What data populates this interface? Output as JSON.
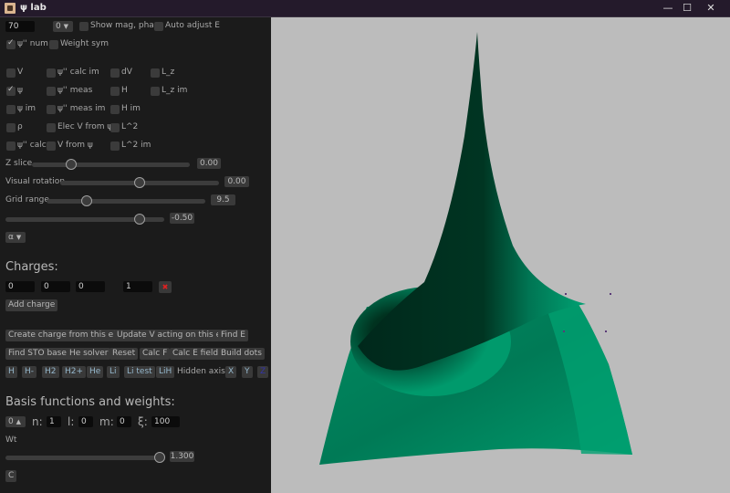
{
  "window": {
    "title": "ψ lab",
    "controls": {
      "minimize": "—",
      "maximize": "☐",
      "close": "✕"
    }
  },
  "top_row": {
    "n_input_value": "70",
    "mode_dropdown": {
      "selected": "0",
      "icon": "▼"
    },
    "show_mag_phase": {
      "label": "Show mag, phase",
      "checked": false
    },
    "auto_adjust_e": {
      "label": "Auto adjust E",
      "checked": false
    },
    "psi_pp_num": {
      "label": "ψ'' num",
      "checked": true
    },
    "weight_sym": {
      "label": "Weight sym",
      "checked": false
    }
  },
  "plot_toggles": [
    {
      "label": "V",
      "checked": false
    },
    {
      "label": "ψ'' calc im",
      "checked": false
    },
    {
      "label": "dV",
      "checked": false
    },
    {
      "label": "L_z",
      "checked": false
    },
    {
      "label": "ψ",
      "checked": true
    },
    {
      "label": "ψ'' meas",
      "checked": false
    },
    {
      "label": "H",
      "checked": false
    },
    {
      "label": "L_z im",
      "checked": false
    },
    {
      "label": "ψ im",
      "checked": false
    },
    {
      "label": "ψ'' meas im",
      "checked": false
    },
    {
      "label": "H im",
      "checked": false
    },
    {
      "label": "ρ",
      "checked": false
    },
    {
      "label": "Elec V from ψ",
      "checked": false
    },
    {
      "label": "L^2",
      "checked": false
    },
    {
      "label": "ψ'' calc",
      "checked": false
    },
    {
      "label": "V from ψ",
      "checked": false
    },
    {
      "label": "L^2 im",
      "checked": false
    }
  ],
  "sliders": {
    "z_slice": {
      "label": "Z slice",
      "value_text": "0.00",
      "fraction": 0.25
    },
    "visual_rotation": {
      "label": "Visual rotation",
      "value_text": "0.00",
      "fraction": 0.5
    },
    "grid_range": {
      "label": "Grid range",
      "value_text": "9.5",
      "fraction": 0.25
    },
    "energy": {
      "label": "",
      "value_text": "-0.50",
      "fraction": 0.845
    }
  },
  "alpha_dropdown": {
    "selected": "α",
    "icon": "▼"
  },
  "charges": {
    "heading": "Charges:",
    "rows": [
      {
        "x": "0",
        "y": "0",
        "z": "0",
        "q": "1",
        "delete_icon": "✖"
      }
    ],
    "add_label": "Add charge"
  },
  "actions_row1": [
    "Create charge from this elec",
    "Update V acting on this elec",
    "Find E"
  ],
  "actions_row2": [
    "Find STO bases",
    "He solver",
    "Reset",
    "Calc F",
    "Calc E field",
    "Build dots"
  ],
  "elements": [
    "H",
    "H-",
    "H2",
    "H2+",
    "He",
    "Li",
    "Li test",
    "LiH"
  ],
  "hidden_axis": {
    "label": "Hidden axis:",
    "options": [
      "X",
      "Y",
      "Z"
    ],
    "selected": "Z"
  },
  "basis": {
    "heading": "Basis functions and weights:",
    "index_dropdown": {
      "selected": "0",
      "icon": "▲"
    },
    "n_label": "n:",
    "n_value": "1",
    "l_label": "l:",
    "l_value": "0",
    "m_label": "m:",
    "m_value": "0",
    "xi_label": "ξ:",
    "xi_value": "100",
    "wt_label": "Wt",
    "wt_value_text": "1.300",
    "wt_fraction": 1.0,
    "c_button": "C"
  },
  "viewport": {
    "background": "#bcbcbc",
    "surface_color": "#00a070",
    "surface_shadow": "#00261a",
    "description": "3D surface plot of ψ with sharp central peak"
  }
}
